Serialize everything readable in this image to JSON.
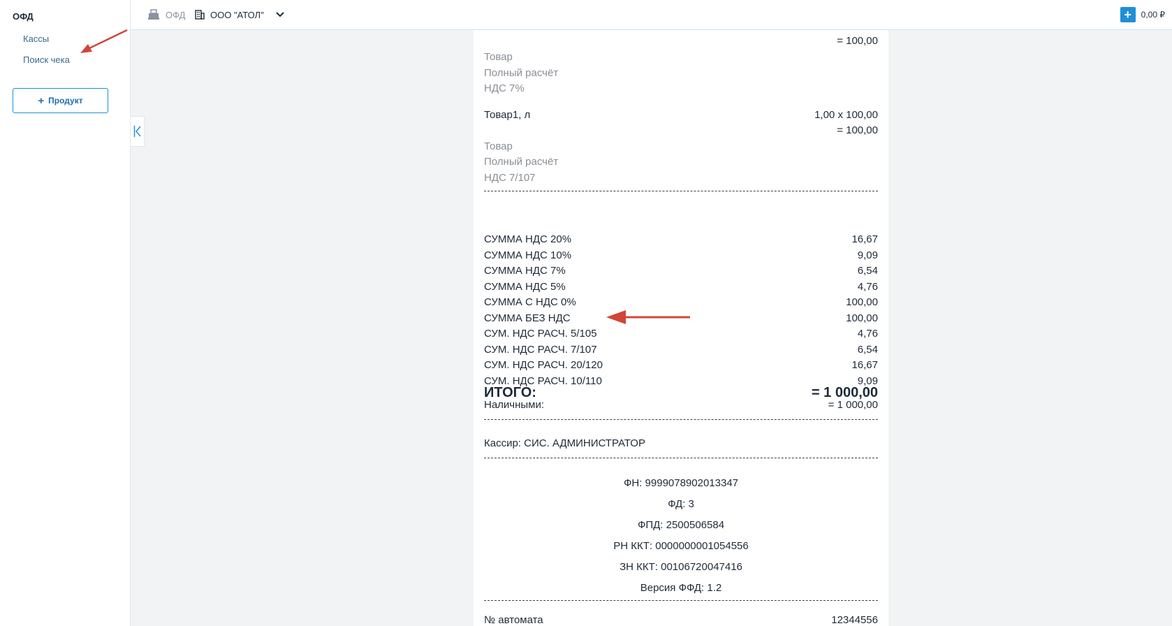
{
  "sidebar": {
    "title": "ОФД",
    "items": [
      {
        "label": "Кассы"
      },
      {
        "label": "Поиск чека"
      }
    ],
    "product_button": "Продукт"
  },
  "topbar": {
    "section": "ОФД",
    "org": "ООО \"АТОЛ\"",
    "balance": "0,00 ₽"
  },
  "receipt": {
    "top_total": "= 100,00",
    "item1_attrs": [
      "Товар",
      "Полный расчёт",
      "НДС 7%"
    ],
    "item2": {
      "name": "Товар1, л",
      "qty_price": "1,00 x 100,00",
      "total": "= 100,00",
      "attrs": [
        "Товар",
        "Полный расчёт",
        "НДС 7/107"
      ]
    },
    "vat_rows": [
      {
        "label": "СУММА НДС 20%",
        "value": "16,67"
      },
      {
        "label": "СУММА НДС 10%",
        "value": "9,09"
      },
      {
        "label": "СУММА НДС 7%",
        "value": "6,54"
      },
      {
        "label": "СУММА НДС 5%",
        "value": "4,76"
      },
      {
        "label": "СУММА С НДС 0%",
        "value": "100,00"
      },
      {
        "label": "СУММА БЕЗ НДС",
        "value": "100,00"
      },
      {
        "label": "СУМ. НДС РАСЧ. 5/105",
        "value": "4,76"
      },
      {
        "label": "СУМ. НДС РАСЧ. 7/107",
        "value": "6,54"
      },
      {
        "label": "СУМ. НДС РАСЧ. 20/120",
        "value": "16,67"
      },
      {
        "label": "СУМ. НДС РАСЧ. 10/110",
        "value": "9,09"
      }
    ],
    "total_label": "ИТОГО:",
    "total_value": "= 1 000,00",
    "cash_label": "Наличными:",
    "cash_value": "= 1 000,00",
    "cashier": "Кассир: СИС. АДМИНИСТРАТОР",
    "fiscal": [
      "ФН: 9999078902013347",
      "ФД: 3",
      "ФПД: 2500506584",
      "РН ККТ: 0000000001054556",
      "ЗН ККТ: 00106720047416",
      "Версия ФФД: 1.2"
    ],
    "machine_label": "№ автомата",
    "machine_value": "12344556"
  },
  "colors": {
    "accent": "#1e8fd8",
    "link": "#3a6a8e",
    "annotation_arrow": "#d0463b"
  }
}
